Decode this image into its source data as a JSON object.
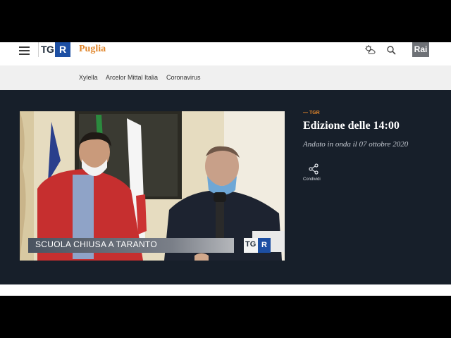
{
  "header": {
    "logo_text": "TG",
    "logo_accent": "R",
    "region": "Puglia",
    "rai_logo": "Rai",
    "icons": [
      "menu-icon",
      "weather-icon",
      "search-icon"
    ]
  },
  "subnav": {
    "items": [
      {
        "label": "Xylella"
      },
      {
        "label": "Arcelor Mittal Italia"
      },
      {
        "label": "Coronavirus"
      }
    ]
  },
  "video": {
    "caption": "SCUOLA CHIUSA A TARANTO",
    "logo_text": "TG",
    "logo_accent": "R"
  },
  "episode": {
    "label": "TGR",
    "title": "Edizione delle 14:00",
    "aired": "Andato in onda il 07 ottobre 2020",
    "share_label": "Condividi"
  },
  "colors": {
    "accent": "#e0852a",
    "brand_blue": "#1d4fa3",
    "dark_bg": "#171f2a"
  }
}
